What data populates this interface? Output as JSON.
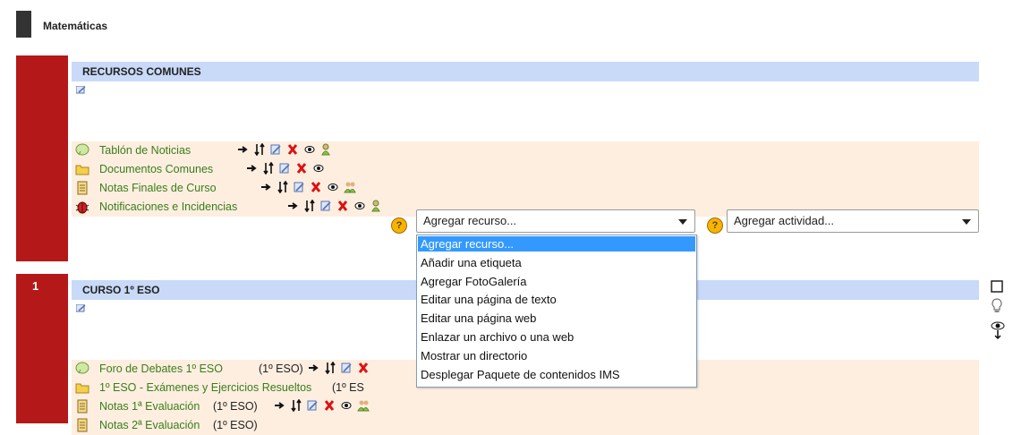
{
  "course": {
    "title": "Matemáticas"
  },
  "sections": [
    {
      "number": "",
      "title": "RECURSOS COMUNES",
      "items": [
        {
          "icon": "forum-icon",
          "label": "Tablón de Noticias",
          "after": ""
        },
        {
          "icon": "folder-icon",
          "label": "Documentos Comunes",
          "after": ""
        },
        {
          "icon": "grade-icon",
          "label": "Notas Finales de Curso",
          "after": ""
        },
        {
          "icon": "bug-icon",
          "label": "Notificaciones e Incidencias",
          "after": ""
        }
      ],
      "add_resource": {
        "value": "Agregar recurso..."
      },
      "add_activity": {
        "value": "Agregar actividad..."
      }
    },
    {
      "number": "1",
      "title": "CURSO 1º ESO",
      "items": [
        {
          "icon": "forum-icon",
          "label": "Foro de Debates 1º ESO",
          "after": "(1º ESO)"
        },
        {
          "icon": "folder-icon",
          "label": "1º ESO - Exámenes y Ejercicios Resueltos",
          "after": "(1º ES"
        },
        {
          "icon": "grade-icon",
          "label": "Notas 1ª Evaluación",
          "after": "(1º ESO)"
        },
        {
          "icon": "grade-icon",
          "label": "Notas 2ª Evaluación",
          "after": "(1º ESO)"
        }
      ]
    }
  ],
  "resource_dropdown": {
    "options": [
      "Agregar recurso...",
      "Añadir una etiqueta",
      "Agregar FotoGalería",
      "Editar una página de texto",
      "Editar una página web",
      "Enlazar un archivo o una web",
      "Mostrar un directorio",
      "Desplegar Paquete de contenidos IMS"
    ],
    "selected": "Agregar recurso..."
  },
  "colors": {
    "section_red": "#b51818",
    "header_blue": "#c9daf8",
    "row_bg": "#fdeee0",
    "link_green": "#3a7d1b"
  }
}
